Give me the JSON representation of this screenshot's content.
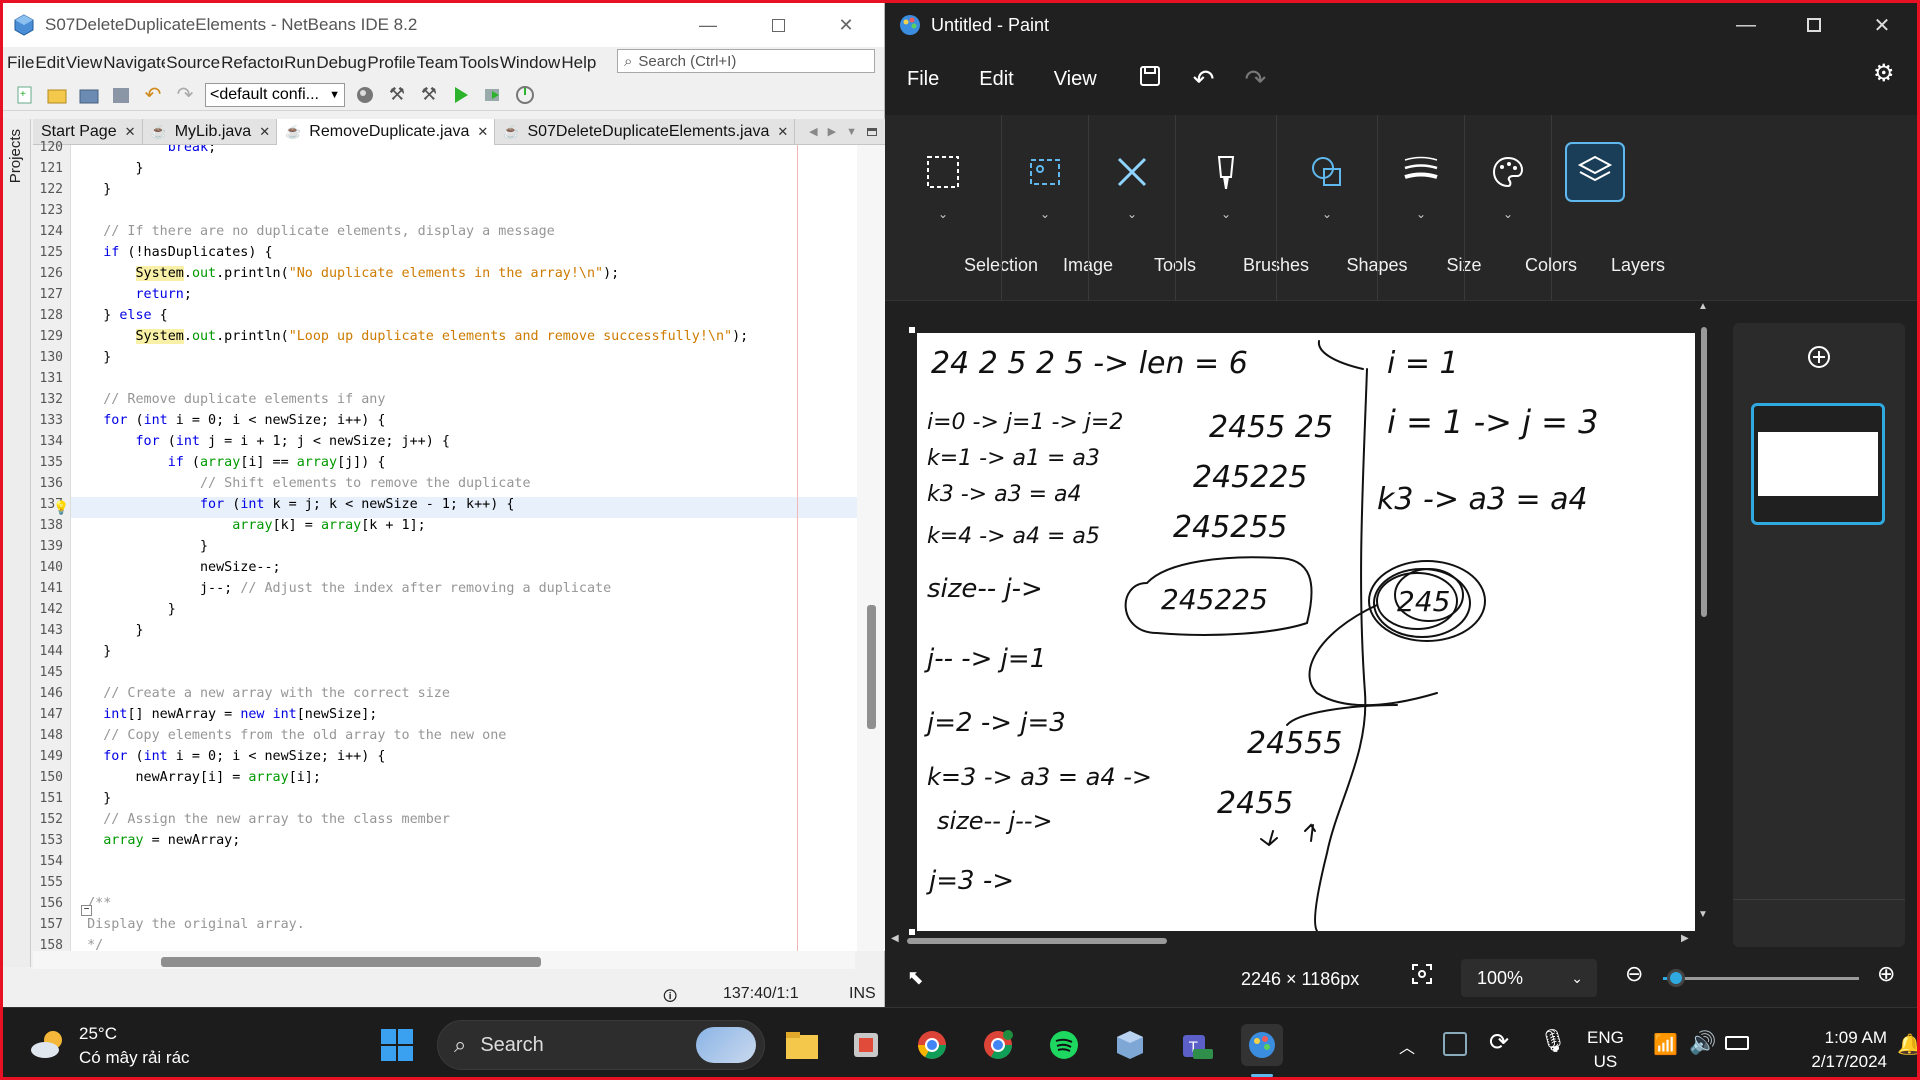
{
  "netbeans": {
    "title": "S07DeleteDuplicateElements - NetBeans IDE 8.2",
    "menu": [
      "File",
      "Edit",
      "View",
      "Navigate",
      "Source",
      "Refactor",
      "Run",
      "Debug",
      "Profile",
      "Team",
      "Tools",
      "Window",
      "Help"
    ],
    "search_placeholder": "Search (Ctrl+I)",
    "config_value": "<default confi...",
    "side_panel_label": "Projects",
    "tabs": [
      "Start Page",
      "MyLib.java",
      "RemoveDuplicate.java",
      "S07DeleteDuplicateElements.java"
    ],
    "active_tab_index": 2,
    "status_position": "137:40/1:1",
    "status_mode": "INS",
    "code_lines": [
      {
        "n": "120",
        "html": "            <span class='kw'>break</span>;"
      },
      {
        "n": "121",
        "html": "        }"
      },
      {
        "n": "122",
        "html": "    }"
      },
      {
        "n": "123",
        "html": ""
      },
      {
        "n": "124",
        "html": "    <span class='cmt'>// If there are no duplicate elements, display a message</span>"
      },
      {
        "n": "125",
        "html": "    <span class='kw'>if</span> (!hasDuplicates) {"
      },
      {
        "n": "126",
        "html": "        <span class='hl'>System</span>.<span class='fld'>out</span>.println(<span class='str'>\"No duplicate elements in the array!\\n\"</span>);"
      },
      {
        "n": "127",
        "html": "        <span class='kw'>return</span>;"
      },
      {
        "n": "128",
        "html": "    } <span class='kw'>else</span> {"
      },
      {
        "n": "129",
        "html": "        <span class='hl'>System</span>.<span class='fld'>out</span>.println(<span class='str'>\"Loop up duplicate elements and remove successfully!\\n\"</span>);"
      },
      {
        "n": "130",
        "html": "    }"
      },
      {
        "n": "131",
        "html": ""
      },
      {
        "n": "132",
        "html": "    <span class='cmt'>// Remove duplicate elements if any</span>"
      },
      {
        "n": "133",
        "html": "    <span class='kw'>for</span> (<span class='kw'>int</span> i = 0; i &lt; newSize; i++) {"
      },
      {
        "n": "134",
        "html": "        <span class='kw'>for</span> (<span class='kw'>int</span> j = i + 1; j &lt; newSize; j++) {"
      },
      {
        "n": "135",
        "html": "            <span class='kw'>if</span> (<span class='fld'>array</span>[i] == <span class='fld'>array</span>[j]) {"
      },
      {
        "n": "136",
        "html": "                <span class='cmt'>// Shift elements to remove the duplicate</span>"
      },
      {
        "n": "137",
        "html": "                <span class='kw'>for</span> (<span class='kw'>int</span> k = j; k &lt; newSize - 1; k++) {"
      },
      {
        "n": "138",
        "html": "                    <span class='fld'>array</span>[k] = <span class='fld'>array</span>[k + 1];"
      },
      {
        "n": "139",
        "html": "                }"
      },
      {
        "n": "140",
        "html": "                newSize--;"
      },
      {
        "n": "141",
        "html": "                j--; <span class='cmt'>// Adjust the index after removing a duplicate</span>"
      },
      {
        "n": "142",
        "html": "            }"
      },
      {
        "n": "143",
        "html": "        }"
      },
      {
        "n": "144",
        "html": "    }"
      },
      {
        "n": "145",
        "html": ""
      },
      {
        "n": "146",
        "html": "    <span class='cmt'>// Create a new array with the correct size</span>"
      },
      {
        "n": "147",
        "html": "    <span class='kw'>int</span>[] newArray = <span class='kw'>new</span> <span class='kw'>int</span>[newSize];"
      },
      {
        "n": "148",
        "html": "    <span class='cmt'>// Copy elements from the old array to the new one</span>"
      },
      {
        "n": "149",
        "html": "    <span class='kw'>for</span> (<span class='kw'>int</span> i = 0; i &lt; newSize; i++) {"
      },
      {
        "n": "150",
        "html": "        newArray[i] = <span class='fld'>array</span>[i];"
      },
      {
        "n": "151",
        "html": "    }"
      },
      {
        "n": "152",
        "html": "    <span class='cmt'>// Assign the new array to the class member</span>"
      },
      {
        "n": "153",
        "html": "    <span class='fld'>array</span> = newArray;"
      },
      {
        "n": "154",
        "html": ""
      },
      {
        "n": "155",
        "html": ""
      },
      {
        "n": "156",
        "html": "  <span class='cmt'>/**</span>"
      },
      {
        "n": "157",
        "html": "  <span class='cmt'>Display the original array.</span>"
      },
      {
        "n": "158",
        "html": "  <span class='cmt'>*/</span>"
      }
    ]
  },
  "paint": {
    "title": "Untitled - Paint",
    "menu": [
      "File",
      "Edit",
      "View"
    ],
    "ribbon_groups": [
      "Selection",
      "Image",
      "Tools",
      "Brushes",
      "Shapes",
      "Size",
      "Colors",
      "Layers"
    ],
    "canvas_dimensions": "2246 × 1186px",
    "zoom_value": "100%",
    "zoom_slider_fraction": 0.12,
    "handwriting": [
      "24 2 5 2 5 -> len = 6",
      "i = 1",
      "i=0 -> j=1 -> j=2",
      "2455 25",
      "k=1 -> a1 = a3",
      "i = 1 -> j = 3",
      "k3 -> a3 = a4",
      "245225",
      "k=4 -> a4 = a5",
      "245255",
      "k3 -> a3 = a4",
      "size-- j->",
      "245225",
      "245",
      "j-- -> j=1",
      "j=2 -> j=3",
      "k=3 -> a3 = a4 ->",
      "24555",
      "size-- j-->",
      "2455",
      "j=3 ->"
    ]
  },
  "taskbar": {
    "weather_temp": "25°C",
    "weather_desc": "Có mây rải rác",
    "search_label": "Search",
    "lang_line1": "ENG",
    "lang_line2": "US",
    "time": "1:09 AM",
    "date": "2/17/2024"
  }
}
